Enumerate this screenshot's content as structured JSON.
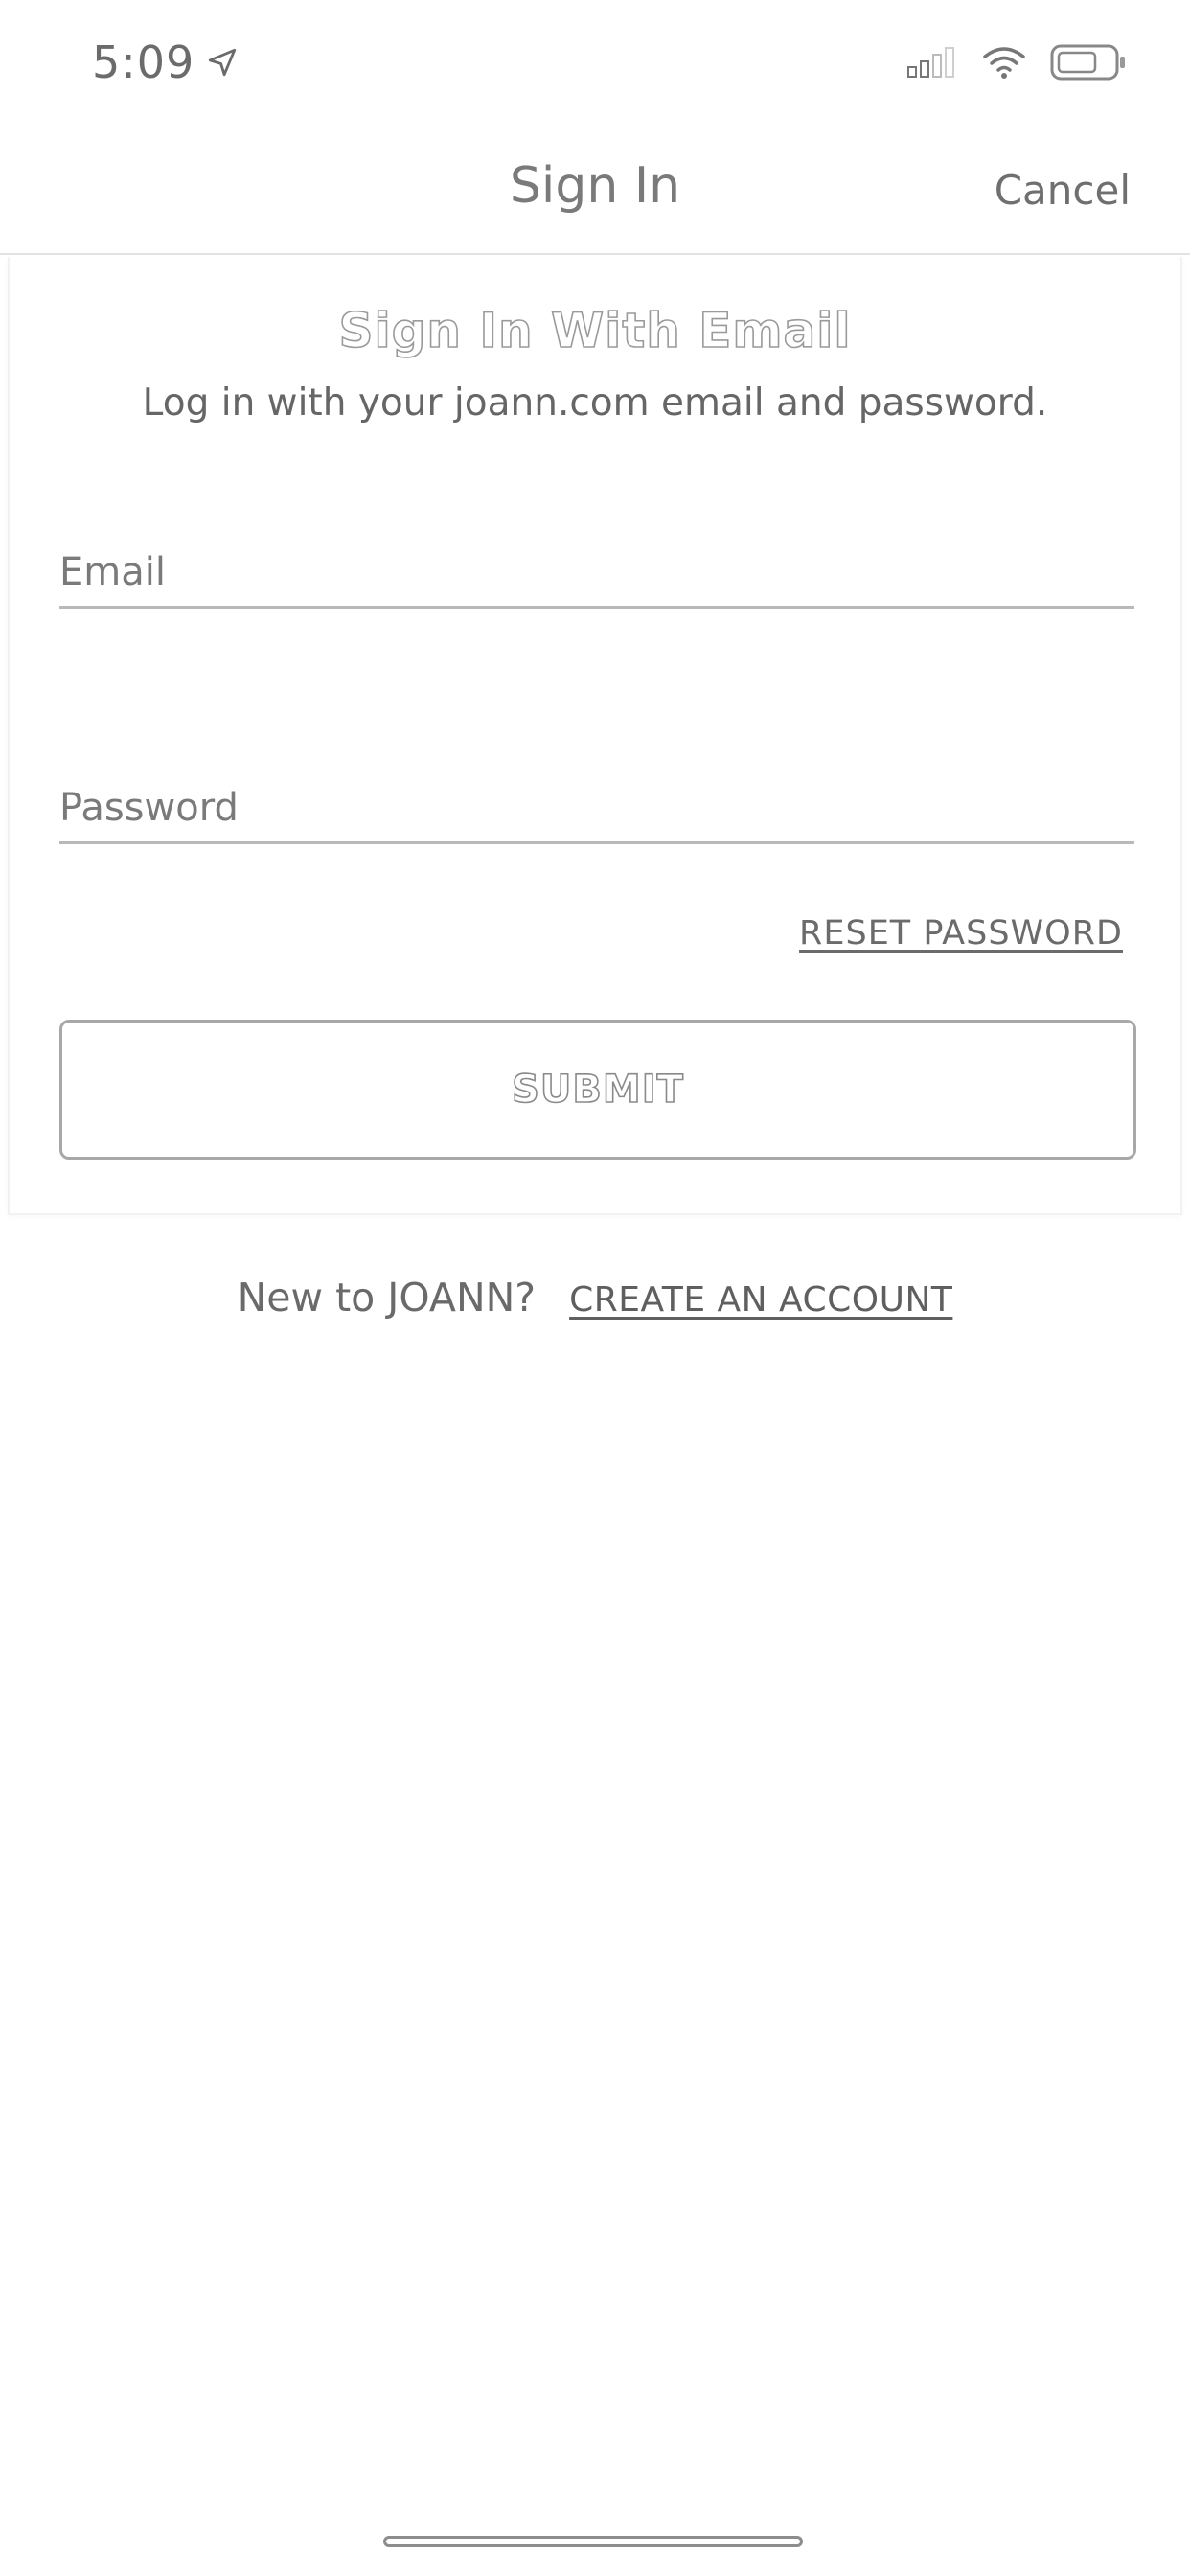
{
  "status_bar": {
    "time": "5:09",
    "icons": [
      "location-arrow-icon",
      "cellular-signal-icon",
      "wifi-icon",
      "battery-icon"
    ]
  },
  "nav": {
    "title": "Sign In",
    "cancel_label": "Cancel"
  },
  "card": {
    "heading": "Sign In With Email",
    "subtext": "Log in with your joann.com email and password."
  },
  "form": {
    "email_placeholder": "Email",
    "email_value": "",
    "password_placeholder": "Password",
    "password_value": "",
    "reset_label": "RESET PASSWORD",
    "submit_label": "SUBMIT"
  },
  "footer": {
    "new_prompt": "New to JOANN?",
    "create_label": "CREATE AN ACCOUNT"
  }
}
